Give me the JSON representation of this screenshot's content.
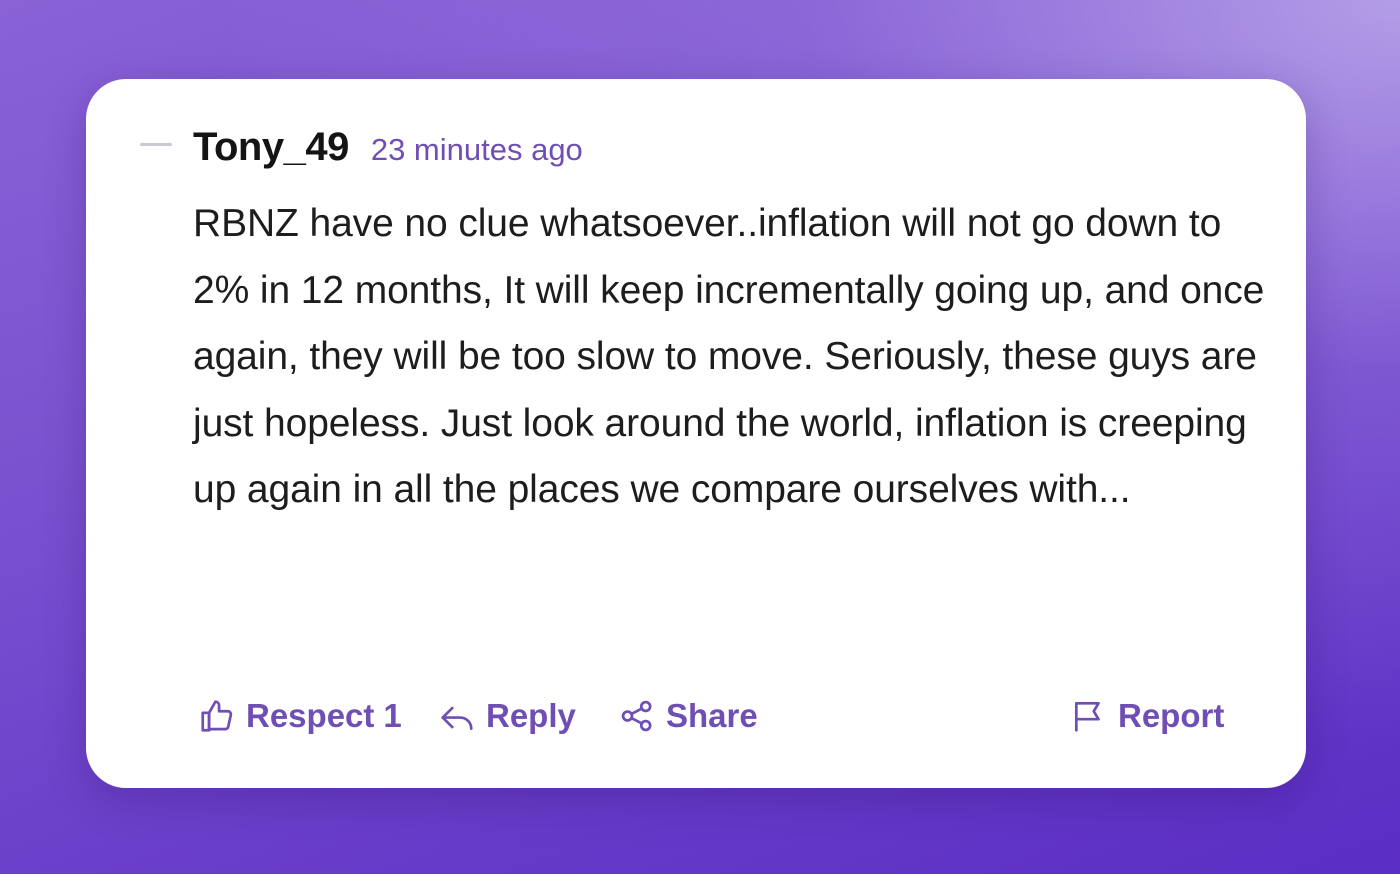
{
  "comment": {
    "username": "Tony_49",
    "timestamp": "23 minutes ago",
    "body": "RBNZ have no clue whatsoever..inflation will not go down to 2% in 12 months, It will keep incrementally going up, and once again, they will be too slow to move. Seriously, these guys are just hopeless. Just look around the world, inflation is creeping up again in all the places we compare ourselves with..."
  },
  "actions": {
    "respect_label": "Respect",
    "respect_count": "1",
    "reply_label": "Reply",
    "share_label": "Share",
    "report_label": "Report"
  },
  "icons": {
    "respect": "thumbs-up-icon",
    "reply": "reply-arrow-icon",
    "share": "share-nodes-icon",
    "report": "flag-icon",
    "collapse": "collapse-dash-icon"
  },
  "colors": {
    "accent": "#6f4fb4",
    "username": "#141414",
    "body_text": "#1d1d1f",
    "card_background": "#ffffff",
    "page_gradient_start": "#8a62d6",
    "page_gradient_end": "#5b2ec4"
  }
}
